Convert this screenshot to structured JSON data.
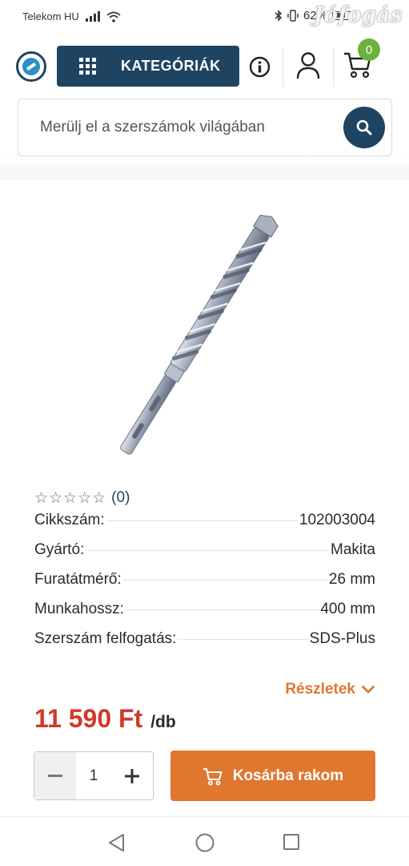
{
  "status_bar": {
    "carrier": "Telekom HU",
    "battery": "62%",
    "watermark": "Jófogás",
    "signal_icon": "signal-icon",
    "wifi_icon": "wifi-icon",
    "bluetooth_icon": "bluetooth-icon"
  },
  "header": {
    "categories_label": "KATEGÓRIÁK",
    "cart_count": "0",
    "search": {
      "placeholder": "Merülj el a szerszámok világában",
      "value": ""
    },
    "brand_color": "#1e4462",
    "accent_color": "#e0772f"
  },
  "product": {
    "image_alt": "SDS-Plus drill bit",
    "rating": {
      "stars": "☆☆☆☆☆",
      "count": "(0)"
    },
    "specs": [
      {
        "label": "Cikkszám:",
        "value": "102003004"
      },
      {
        "label": "Gyártó:",
        "value": "Makita"
      },
      {
        "label": "Furatátmérő:",
        "value": "26 mm"
      },
      {
        "label": "Munkahossz:",
        "value": "400 mm"
      },
      {
        "label": "Szerszám felfogatás:",
        "value": "SDS-Plus"
      }
    ],
    "details_label": "Részletek",
    "price": "11 590 Ft",
    "unit": "/db",
    "quantity": "1",
    "add_to_cart_label": "Kosárba rakom"
  }
}
